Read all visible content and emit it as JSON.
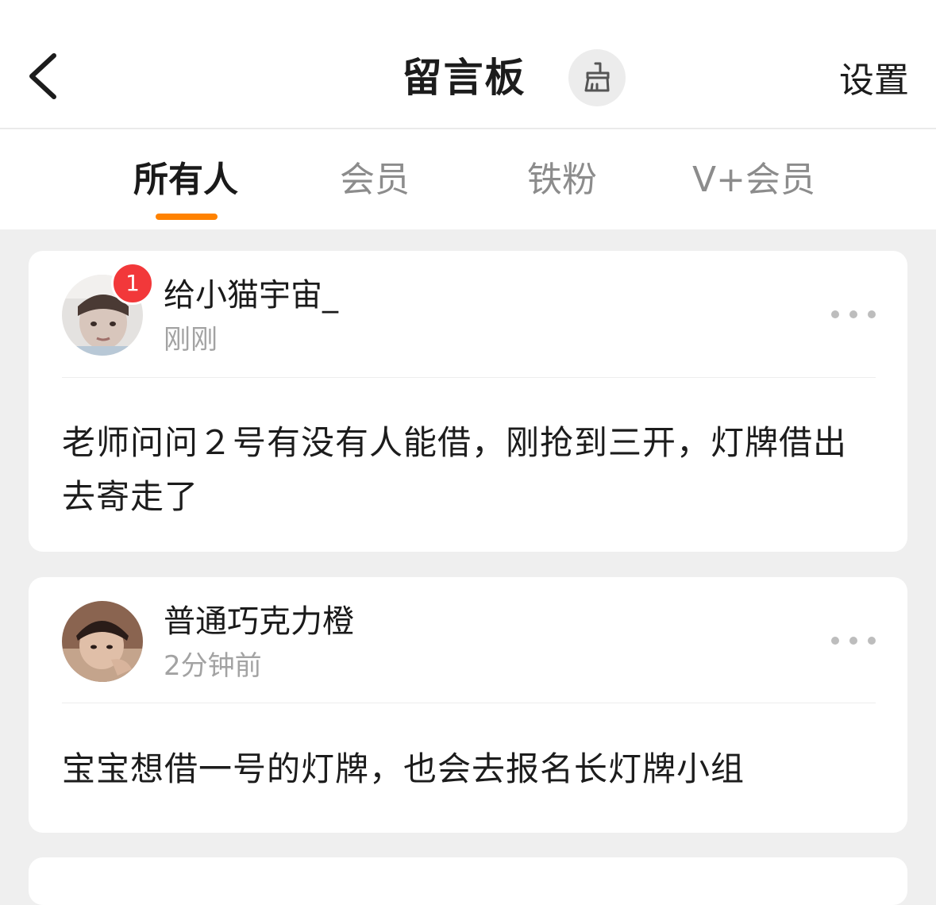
{
  "header": {
    "title": "留言板",
    "settings_label": "设置",
    "back_icon": "chevron-left-icon",
    "clean_icon": "broom-icon"
  },
  "tabs": [
    {
      "label": "所有人",
      "active": true
    },
    {
      "label": "会员",
      "active": false
    },
    {
      "label": "铁粉",
      "active": false
    },
    {
      "label": "V+会员",
      "active": false
    }
  ],
  "colors": {
    "accent": "#ff8200",
    "badge": "#f2383a",
    "background": "#efefef"
  },
  "messages": [
    {
      "username": "给小猫宇宙_",
      "time": "刚刚",
      "badge": "1",
      "content": "老师问问２号有没有人能借，刚抢到三开，灯牌借出去寄走了"
    },
    {
      "username": "普通巧克力橙",
      "time": "2分钟前",
      "content": "宝宝想借一号的灯牌，也会去报名长灯牌小组"
    }
  ]
}
